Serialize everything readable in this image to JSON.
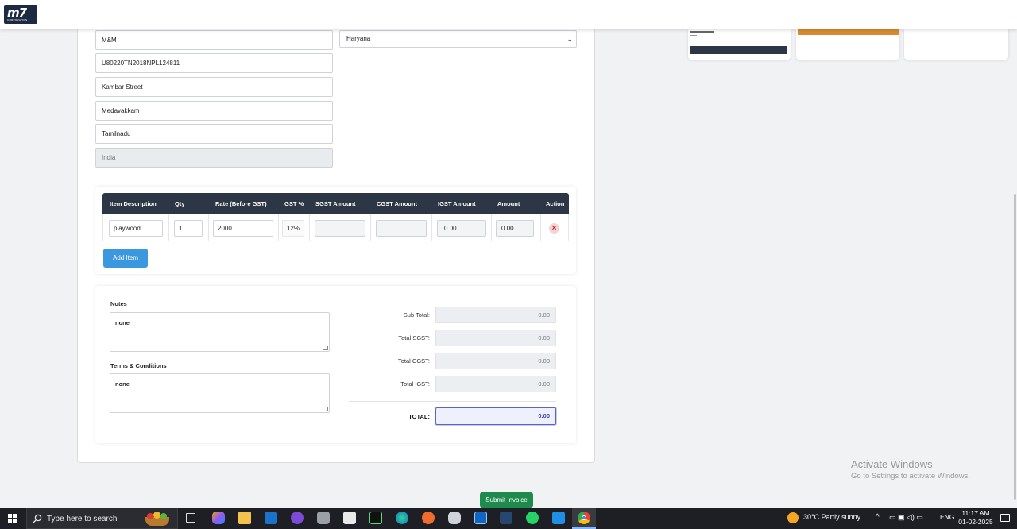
{
  "app": {
    "logo_text": "m7",
    "logo_sub": "CORPORATION"
  },
  "company": {
    "name": "M&M",
    "cin": "U80220TN2018NPL124811",
    "street": "Kambar Street",
    "area": "Medavakkam",
    "state": "Tamilnadu",
    "country": "India",
    "place_of_supply": "Haryana"
  },
  "items_table": {
    "headers": [
      "Item Description",
      "Qty",
      "Rate (Before GST)",
      "GST %",
      "SGST Amount",
      "CGST Amount",
      "IGST Amount",
      "Amount",
      "Action"
    ],
    "rows": [
      {
        "description": "playwood",
        "qty": "1",
        "rate": "2000",
        "gst": "12%",
        "sgst": "",
        "cgst": "",
        "igst": "0.00",
        "amount": "0.00"
      }
    ],
    "add_label": "Add Item"
  },
  "notes": {
    "label": "Notes",
    "value": "none"
  },
  "terms": {
    "label": "Terms & Conditions",
    "value": "none"
  },
  "totals": {
    "sub_total_label": "Sub Total:",
    "sub_total": "0.00",
    "sgst_label": "Total SGST:",
    "sgst": "0.00",
    "cgst_label": "Total CGST:",
    "cgst": "0.00",
    "igst_label": "Total IGST:",
    "igst": "0.00",
    "total_label": "TOTAL:",
    "total": "0.00"
  },
  "submit_label": "Submit Invoice",
  "watermark": {
    "title": "Activate Windows",
    "subtitle": "Go to Settings to activate Windows."
  },
  "taskbar": {
    "search_placeholder": "Type here to search",
    "weather": "30°C  Partly sunny",
    "lang": "ENG",
    "time": "11:17 AM",
    "date": "01-02-2025"
  },
  "colors": {
    "header": "#2c3645",
    "accent": "#3b97de",
    "submit": "#1e8a4d",
    "delete": "#c62828"
  }
}
